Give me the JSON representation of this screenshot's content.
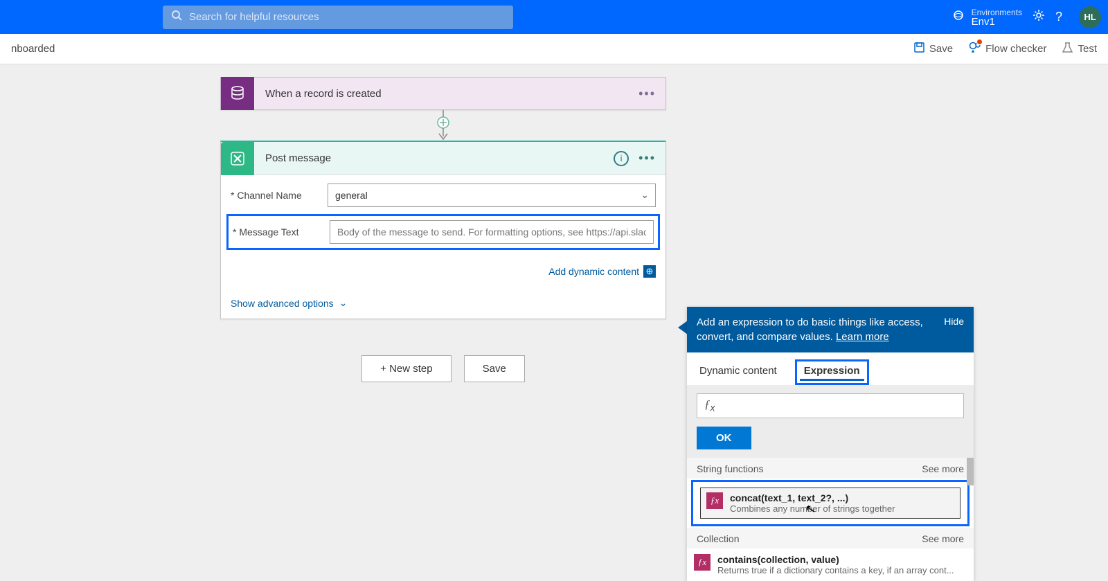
{
  "header": {
    "search_placeholder": "Search for helpful resources",
    "env_label": "Environments",
    "env_name": "Env1",
    "avatar_initials": "HL"
  },
  "subbar": {
    "left_text": "nboarded",
    "save": "Save",
    "flow_checker": "Flow checker",
    "test": "Test"
  },
  "trigger": {
    "title": "When a record is created"
  },
  "action": {
    "title": "Post message",
    "fields": {
      "channel_label": "* Channel Name",
      "channel_value": "general",
      "message_label": "* Message Text",
      "message_placeholder": "Body of the message to send. For formatting options, see https://api.slack.com"
    },
    "add_dynamic": "Add dynamic content",
    "show_advanced": "Show advanced options"
  },
  "buttons": {
    "new_step": "+ New step",
    "save": "Save"
  },
  "popout": {
    "head_text": "Add an expression to do basic things like access, convert, and compare values. ",
    "learn_more": "Learn more",
    "hide": "Hide",
    "tab_dynamic": "Dynamic content",
    "tab_expression": "Expression",
    "ok": "OK",
    "sections": [
      {
        "title": "String functions",
        "see_more": "See more",
        "items": [
          {
            "sig": "concat(text_1, text_2?, ...)",
            "desc": "Combines any number of strings together"
          }
        ]
      },
      {
        "title": "Collection",
        "see_more": "See more",
        "items": [
          {
            "sig": "contains(collection, value)",
            "desc": "Returns true if a dictionary contains a key, if an array cont..."
          }
        ]
      }
    ]
  }
}
